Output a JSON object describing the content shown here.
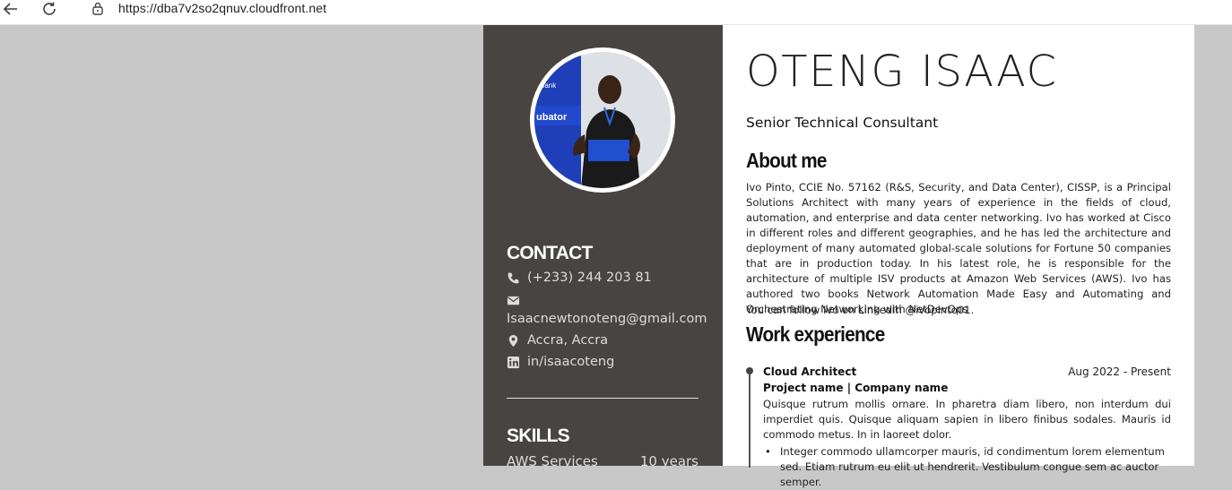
{
  "browser": {
    "url": "https://dba7v2so2qnuv.cloudfront.net"
  },
  "sidebar": {
    "contact_heading": "CONTACT",
    "phone": "(+233) 244 203 81",
    "email": "Isaacnewtonoteng@gmail.com",
    "location": "Accra, Accra",
    "linkedin": "in/isaacoteng",
    "skills_heading": "SKILLS",
    "skills": [
      {
        "name": "AWS Services",
        "years": "10 years"
      }
    ],
    "photo_caption": "Bank ubator"
  },
  "main": {
    "name": "OTENG ISAAC",
    "title": "Senior Technical Consultant",
    "about_heading": "About me",
    "about_text": "Ivo Pinto, CCIE No. 57162 (R&S, Security, and Data Center), CISSP, is a Principal Solutions Architect with many years of experience in the fields of cloud, automation, and enterprise and data center networking. Ivo has worked at Cisco in different roles and different geographies, and he has led the architecture and deployment of many automated global-scale solutions for Fortune 50 companies that are in production today. In his latest role, he is responsible for the architecture of multiple ISV products at Amazon Web Services (AWS). Ivo has authored two books Network Automation Made Easy and Automating and Orchestrating Networking with NetDevOps",
    "follow_text": "You can follow Ivo on LinkedIn @ivopinto01.",
    "work_heading": "Work experience",
    "experience": [
      {
        "role": "Cloud Architect",
        "dates": "Aug 2022 - Present",
        "project": "Project name | Company name",
        "description": "Quisque rutrum mollis ornare. In pharetra diam libero, non interdum dui imperdiet quis. Quisque aliquam sapien in libero finibus sodales. Mauris id commodo metus. In in laoreet dolor.",
        "bullets": [
          "Integer commodo ullamcorper mauris, id condimentum lorem elementum sed. Etiam rutrum eu elit ut hendrerit. Vestibulum congue sem ac auctor semper."
        ]
      }
    ]
  }
}
